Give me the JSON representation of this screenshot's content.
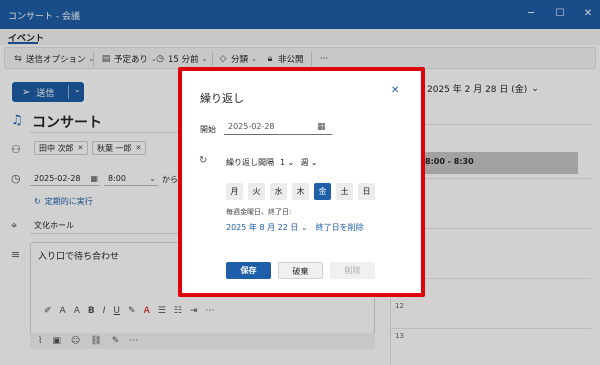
{
  "window": {
    "title": "コンサート - 会議",
    "minimize_glyph": "─",
    "maximize_glyph": "☐",
    "close_glyph": "✕"
  },
  "tabs": {
    "event": "イベント"
  },
  "ribbon": {
    "send_options": "送信オプション",
    "busy_status": "予定あり",
    "reminder": "15 分前",
    "category": "分類",
    "private": "非公開",
    "more": "···"
  },
  "compose": {
    "send_label": "送信",
    "title": "コンサート",
    "attendees": [
      "田中 次郎",
      "秋葉 一郎"
    ],
    "start_date": "2025-02-28",
    "start_time": "8:00",
    "to_text": "から",
    "recurrence_link": "定期的に実行",
    "location": "文化ホール",
    "notes": "入り口で待ち合わせ"
  },
  "calendar": {
    "date_heading": "2025 年 2 月 28 日 (金)",
    "event_time": "8:00 - 8:30",
    "hour_labels": [
      "11",
      "12",
      "13"
    ]
  },
  "dialog": {
    "title": "繰り返し",
    "close_glyph": "✕",
    "start_label": "開始",
    "start_value": "2025-02-28",
    "interval_label": "繰り返し間隔",
    "interval_value": "1",
    "interval_unit": "週",
    "days": [
      "月",
      "火",
      "水",
      "木",
      "金",
      "土",
      "日"
    ],
    "selected_day": "金",
    "rule_text": "毎週金曜日、終了日:",
    "end_date": "2025 年 8 月 22 日",
    "remove_end_date": "終了日を削除",
    "save": "保存",
    "discard": "破棄",
    "delete": "削除"
  },
  "colors": {
    "accent": "#1f5ea8",
    "highlight_frame": "#e0000b"
  }
}
